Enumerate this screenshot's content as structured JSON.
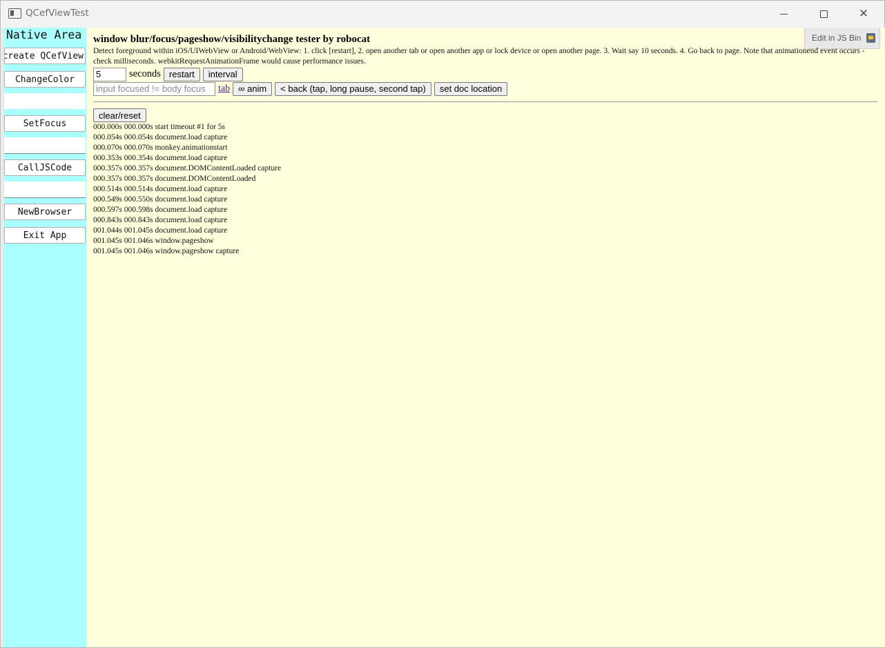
{
  "window": {
    "title": "QCefViewTest",
    "close_glyph": "✕"
  },
  "native": {
    "title": "Native Area",
    "buttons": {
      "recreate": "Recreate QCefView",
      "change_color": "ChangeColor",
      "set_focus": "SetFocus",
      "call_js": "CallJSCode",
      "new_browser": "NewBrowser",
      "exit_app": "Exit App"
    },
    "background_color": "#aaffff"
  },
  "web": {
    "background_color": "#ffffdd",
    "jsbin_label": "Edit in JS Bin",
    "heading": "window blur/focus/pageshow/visibilitychange tester by robocat",
    "description": "Detect foreground within iOS/UIWebView or Android/WebView: 1. click [restart], 2. open another tab or open another app or lock device or open another page. 3. Wait say 10 seconds. 4. Go back to page. Note that animationend event occurs - check milliseconds. webkitRequestAnimationFrame would cause performance issues.",
    "seconds_value": "5",
    "seconds_label": "seconds",
    "restart_label": "restart",
    "interval_label": "interval",
    "focus_placeholder": "input focused != body focus",
    "tab_link": "tab",
    "anim_label": "∞ anim",
    "back_label": "< back (tap, long pause, second tap)",
    "set_doc_location_label": "set doc location",
    "clear_label": "clear/reset",
    "log": [
      "000.000s 000.000s start timeout #1 for 5s",
      "000.054s 000.054s document.load capture",
      "000.070s 000.070s monkey.animationstart",
      "000.353s 000.354s document.load capture",
      "000.357s 000.357s document.DOMContentLoaded capture",
      "000.357s 000.357s document.DOMContentLoaded",
      "000.514s 000.514s document.load capture",
      "000.549s 000.550s document.load capture",
      "000.597s 000.598s document.load capture",
      "000.843s 000.843s document.load capture",
      "001.044s 001.045s document.load capture",
      "001.045s 001.046s window.pageshow",
      "001.045s 001.046s window.pageshow capture"
    ]
  }
}
